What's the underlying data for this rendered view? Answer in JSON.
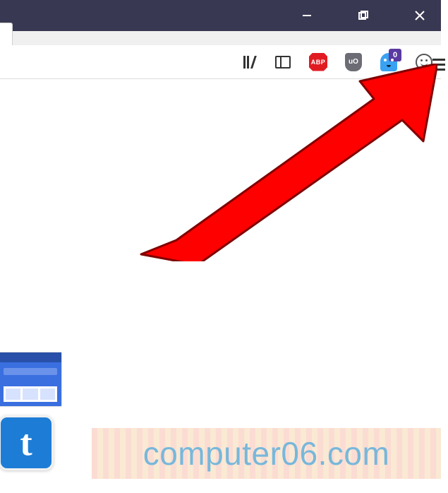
{
  "window": {
    "minimize_tip": "Minimize",
    "maximize_tip": "Maximize",
    "close_tip": "Close"
  },
  "toolbar": {
    "library_tip": "Library",
    "sidebar_tip": "Toggle sidebar",
    "abp_label": "ABP",
    "abp_tip": "Adblock Plus",
    "ublock_label": "uO",
    "ublock_tip": "uBlock Origin",
    "ghostery_tip": "Ghostery",
    "ghostery_badge": "0",
    "account_tip": "Account",
    "menu_tip": "Open menu"
  },
  "snippet": {
    "tile_letter": "t"
  },
  "watermark": {
    "text": "computer06.com"
  },
  "annotation": {
    "arrow_target": "menu-button",
    "arrow_color": "#ff0000"
  }
}
